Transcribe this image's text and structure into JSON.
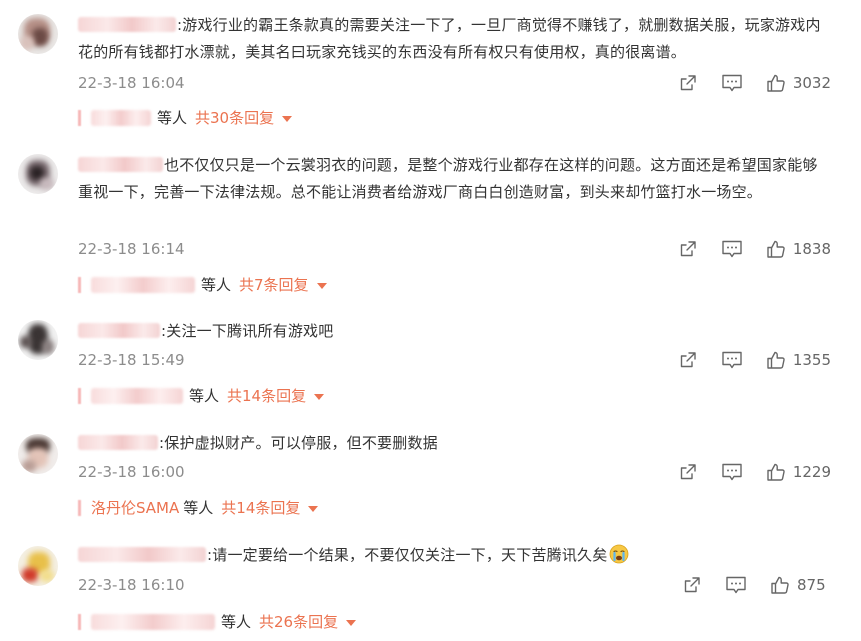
{
  "comments": [
    {
      "text": ":游戏行业的霸王条款真的需要关注一下了，一旦厂商觉得不赚钱了，就删数据关服，玩家游戏内花的所有钱都打水漂就，美其名曰玩家充钱买的东西没有所有权只有使用权，真的很离谱。",
      "timestamp": "22-3-18 16:04",
      "likes": "3032",
      "reply_label": "等人",
      "reply_total": "共30条回复",
      "reply_name": ""
    },
    {
      "text": "也不仅仅只是一个云裳羽衣的问题，是整个游戏行业都存在这样的问题。这方面还是希望国家能够重视一下，完善一下法律法规。总不能让消费者给游戏厂商白白创造财富，到头来却竹篮打水一场空。",
      "timestamp": "22-3-18 16:14",
      "likes": "1838",
      "reply_label": "等人",
      "reply_total": "共7条回复",
      "reply_name": ""
    },
    {
      "text": ":关注一下腾讯所有游戏吧",
      "timestamp": "22-3-18 15:49",
      "likes": "1355",
      "reply_label": "等人",
      "reply_total": "共14条回复",
      "reply_name": ""
    },
    {
      "text": ":保护虚拟财产。可以停服，但不要删数据",
      "timestamp": "22-3-18 16:00",
      "likes": "1229",
      "reply_label": "等人",
      "reply_total": "共14条回复",
      "reply_name": "洛丹伦SAMA"
    },
    {
      "text": ":请一定要给一个结果，不要仅仅关注一下，天下苦腾讯久矣",
      "timestamp": "22-3-18 16:10",
      "likes": "875",
      "reply_label": "等人",
      "reply_total": "共26条回复",
      "reply_name": ""
    }
  ],
  "icons": {
    "share": "share-icon",
    "comment": "comment-icon",
    "like": "thumbs-up-icon",
    "emoji": "crying-face-emoji"
  },
  "colors": {
    "accent": "#eb7350",
    "timestamp": "#8c8c8c",
    "text": "#333333"
  }
}
